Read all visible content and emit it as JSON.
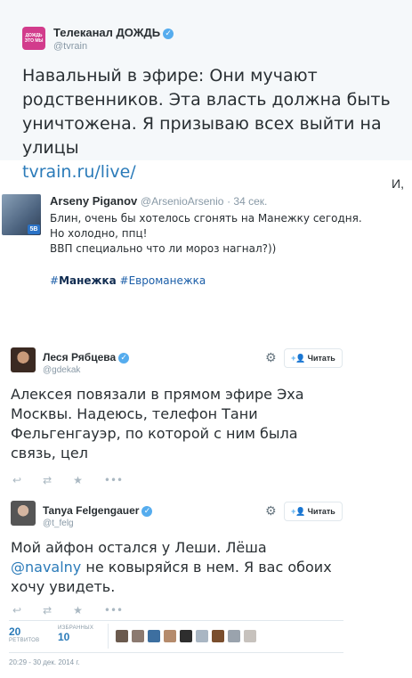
{
  "tweet1": {
    "avatar_text": "ДОЖДЬ ЭТО МЫ",
    "name": "Телеканал ДОЖДЬ",
    "handle": "@tvrain",
    "line1": "Навальный в эфире: Они мучают",
    "line2": "родственников. Эта власть должна быть",
    "line3": "уничтожена. Я призываю всех выйти на улицы",
    "link": "tvrain.ru/live/"
  },
  "tweet2": {
    "stray_text": "И,",
    "avatar_badge": "5B",
    "name": "Arseny Piganov",
    "handle": "@ArsenioArsenio",
    "time": "· 34 сек.",
    "line1": "Блин, очень бы хотелось сгонять на Манежку сегодня.",
    "line2": "Но холодно, ппц!",
    "line3": "ВВП специально что ли мороз нагнал?))",
    "tag1_hash": "#",
    "tag1": "Манежка",
    "tag2": "#Евроманежка"
  },
  "tweet3": {
    "name": "Леся Рябцева",
    "handle": "@gdekak",
    "follow_label": "Читать",
    "line1": "Алексея повязали в прямом эфире Эха",
    "line2": "Москвы. Надеюсь, телефон Тани",
    "line3": "Фельгенгауэр, по которой с ним была",
    "line4": "связь, цел"
  },
  "tweet4": {
    "name": "Tanya Felgengauer",
    "handle": "@t_felg",
    "follow_label": "Читать",
    "line1": "Мой айфон остался у Леши. Лёша",
    "mention": "@navalny",
    "line2_rest": " не ковыряйся в нем. Я вас обоих",
    "line3": "хочу увидеть.",
    "retweets_count": "20",
    "retweets_label": "РЕТВИТОВ",
    "favorites_label": "ИЗБРАННЫХ",
    "favorites_count": "10",
    "date": "20:29 - 30 дек. 2014 г."
  },
  "icons": {
    "reply": "↩",
    "retweet": "⇄",
    "favorite": "★",
    "more": "•••",
    "gear": "⚙",
    "follow": "+👤",
    "verified": "✓"
  },
  "colors": {
    "link": "#2b7bb9",
    "verified": "#55acee",
    "hashtag": "#1b5ea8",
    "muted": "#8899a6"
  }
}
